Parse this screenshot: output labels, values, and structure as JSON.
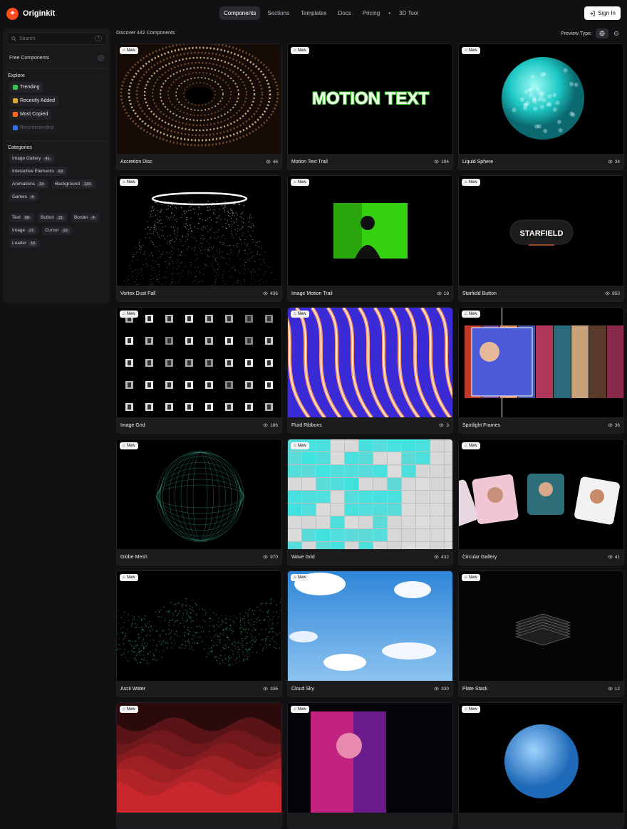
{
  "app": {
    "name": "Originkit"
  },
  "nav": {
    "items": [
      "Components",
      "Sections",
      "Templates",
      "Docs",
      "Pricing",
      "3D Tool"
    ],
    "active": "Components"
  },
  "auth": {
    "signin_label": "Sign In"
  },
  "sidebar": {
    "search": {
      "placeholder": "Search",
      "shortcut": "/"
    },
    "free_components": "Free Components",
    "explore_title": "Explore",
    "explore": [
      {
        "label": "Trending",
        "color": "#3fbf5a"
      },
      {
        "label": "Recently Added",
        "color": "#e0a83a"
      },
      {
        "label": "Most Copied",
        "color": "#ff6a2a"
      },
      {
        "label": "Recommended",
        "color": "#3a6fe0"
      }
    ],
    "categories_title": "Categories",
    "categories": [
      {
        "label": "Image Gallery",
        "count": "41"
      },
      {
        "label": "Interactive Elements",
        "count": "63"
      },
      {
        "label": "Animations",
        "count": "33"
      },
      {
        "label": "Background",
        "count": "133"
      },
      {
        "label": "Games",
        "count": "4"
      },
      {
        "label": "Text",
        "count": "68"
      },
      {
        "label": "Button",
        "count": "21"
      },
      {
        "label": "Border",
        "count": "4"
      },
      {
        "label": "Image",
        "count": "37"
      },
      {
        "label": "Cursor",
        "count": "22"
      },
      {
        "label": "Loader",
        "count": "16"
      }
    ]
  },
  "main": {
    "discover": "Discover 442 Components",
    "preview_label": "Preview Type:",
    "badge": "New",
    "cards": [
      {
        "title": "Accretion Disc",
        "views": "46"
      },
      {
        "title": "Motion Text Trail",
        "views": "194",
        "art_text": "MOTION TEXT"
      },
      {
        "title": "Liquid Sphere",
        "views": "34"
      },
      {
        "title": "Vortex Dust Fall",
        "views": "436"
      },
      {
        "title": "Image Motion Trail",
        "views": "18"
      },
      {
        "title": "Starfield Button",
        "views": "850",
        "art_text": "STARFIELD"
      },
      {
        "title": "Image Grid",
        "views": "186"
      },
      {
        "title": "Fluid Ribbons",
        "views": "3"
      },
      {
        "title": "Spotlight Frames",
        "views": "36"
      },
      {
        "title": "Globe Mesh",
        "views": "970"
      },
      {
        "title": "Wave Grid",
        "views": "432"
      },
      {
        "title": "Circular Gallery",
        "views": "41"
      },
      {
        "title": "Ascii Water",
        "views": "336"
      },
      {
        "title": "Cloud Sky",
        "views": "330"
      },
      {
        "title": "Plate Stack",
        "views": "12"
      },
      {
        "title": "",
        "views": ""
      },
      {
        "title": "",
        "views": ""
      },
      {
        "title": "",
        "views": ""
      }
    ]
  }
}
